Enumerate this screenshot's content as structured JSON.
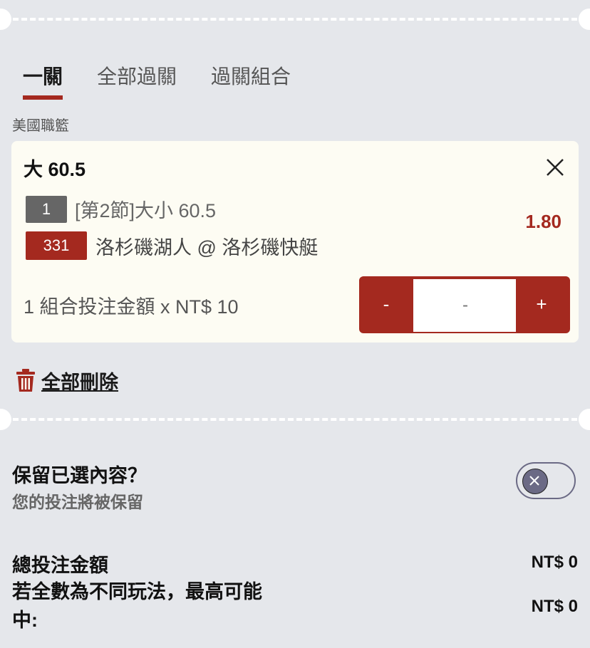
{
  "tabs": [
    {
      "label": "一關",
      "active": true
    },
    {
      "label": "全部過關",
      "active": false
    },
    {
      "label": "過關組合",
      "active": false
    }
  ],
  "league": "美國職籃",
  "bet": {
    "selection": "大 60.5",
    "line_badge": "1",
    "market": "[第2節]大小 60.5",
    "event_badge": "331",
    "match": "洛杉磯湖人 @ 洛杉磯快艇",
    "odds": "1.80",
    "stake_label": "1 組合投注金額 x NT$ 10",
    "stepper": {
      "minus": "-",
      "placeholder": "-",
      "plus": "+"
    },
    "close_icon": "close-icon"
  },
  "actions": {
    "delete_all": "全部刪除",
    "icon": "trash-icon"
  },
  "keep": {
    "title": "保留已選內容？",
    "subtitle": "您的投注將被保留",
    "toggle_on": false
  },
  "summary": {
    "total_label": "總投注金額",
    "total_value": "NT$ 0",
    "max_win_label": "若全數為不同玩法，最高可能中:",
    "max_win_value": "NT$ 0"
  },
  "colors": {
    "accent": "#a4291f",
    "background": "#e5e7eb",
    "card": "#fdfcf3",
    "toggle": "#6b6a85"
  }
}
